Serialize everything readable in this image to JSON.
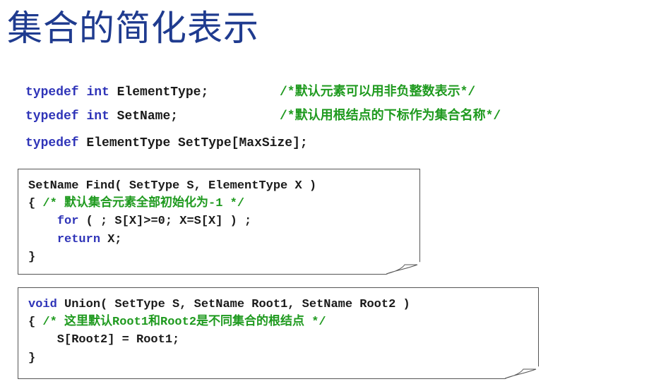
{
  "title": "集合的简化表示",
  "typedefs": [
    {
      "kw": "typedef",
      "sp1": " ",
      "type": "int",
      "rest": " ElementType;",
      "comment": "/*默认元素可以用非负整数表示*/"
    },
    {
      "kw": "typedef",
      "sp1": " ",
      "type": "int",
      "rest": " SetName;",
      "comment": "/*默认用根结点的下标作为集合名称*/"
    },
    {
      "kw": "typedef",
      "rest": " ElementType SetType[MaxSize];"
    }
  ],
  "find_panel": {
    "line1": "SetName Find( SetType S, ElementType X )",
    "line2_brace": "{ ",
    "line2_comment": "/* 默认集合元素全部初始化为-1 */",
    "line3_indent": "    ",
    "line3_kw": "for",
    "line3_rest": " ( ; S[X]>=0; X=S[X] ) ;",
    "line4_indent": "    ",
    "line4_kw": "return",
    "line4_rest": " X;",
    "line5": "}"
  },
  "union_panel": {
    "line1_kw": "void",
    "line1_rest": " Union( SetType S, SetName Root1, SetName Root2 )",
    "line2_brace": "{ ",
    "line2_comment": "/* 这里默认Root1和Root2是不同集合的根结点 */",
    "line3": "    S[Root2] = Root1;",
    "line4": "}"
  },
  "colors": {
    "title": "#1f3b8f",
    "keyword": "#2f34b8",
    "comment": "#1f9a1f",
    "text": "#1a1a1a"
  }
}
